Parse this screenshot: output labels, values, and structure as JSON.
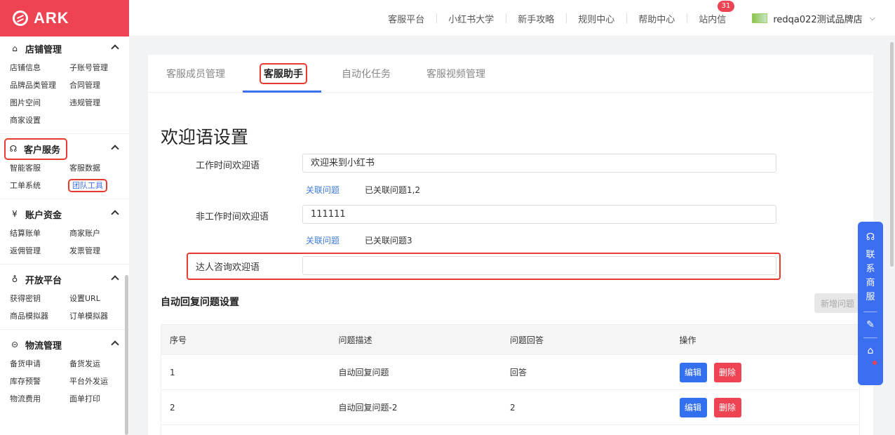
{
  "app": {
    "logo_text": "ARK",
    "accent": "#ee4352",
    "primary": "#3b6ef0"
  },
  "topnav": {
    "links": [
      "客服平台",
      "小红书大学",
      "新手攻略",
      "规则中心",
      "帮助中心",
      "站内信"
    ],
    "inbox_count": "31",
    "store_name": "redqa022测试品牌店"
  },
  "sidebar": {
    "groups": [
      {
        "title": "店铺管理",
        "icon": "store-icon",
        "items": [
          "店铺信息",
          "子账号管理",
          "品牌品类管理",
          "合同管理",
          "图片空间",
          "违规管理",
          "商家设置"
        ]
      },
      {
        "title": "客户服务",
        "icon": "headset-icon",
        "items": [
          "智能客服",
          "客服数据",
          "工单系统",
          "团队工具"
        ]
      },
      {
        "title": "账户资金",
        "icon": "yen-icon",
        "items": [
          "结算账单",
          "商家账户",
          "返佣管理",
          "发票管理"
        ]
      },
      {
        "title": "开放平台",
        "icon": "planet-icon",
        "items": [
          "获得密钥",
          "设置URL",
          "商品模拟器",
          "订单模拟器"
        ]
      },
      {
        "title": "物流管理",
        "icon": "box-icon",
        "items": [
          "备货申请",
          "备货发运",
          "库存预警",
          "平台外发运",
          "物流费用",
          "面单打印"
        ]
      }
    ]
  },
  "tabs": [
    "客服成员管理",
    "客服助手",
    "自动化任务",
    "客服视频管理"
  ],
  "page": {
    "title": "欢迎语设置",
    "work_label": "工作时间欢迎语",
    "work_value": "欢迎来到小红书",
    "link_label": "关联问题",
    "work_linked": "已关联问题1,2",
    "offwork_label": "非工作时间欢迎语",
    "offwork_value": "111111",
    "offwork_linked": "已关联问题3",
    "talent_label": "达人咨询欢迎语",
    "talent_value": "",
    "section_title": "自动回复问题设置",
    "add_button": "新增问题"
  },
  "table": {
    "headers": [
      "序号",
      "问题描述",
      "问题回答",
      "操作"
    ],
    "rows": [
      {
        "no": "1",
        "desc": "自动回复问题",
        "answer": "回答"
      },
      {
        "no": "2",
        "desc": "自动回复问题-2",
        "answer": "2"
      }
    ],
    "edit_label": "编辑",
    "delete_label": "删除"
  },
  "float_widget": {
    "text": "联系商服"
  }
}
